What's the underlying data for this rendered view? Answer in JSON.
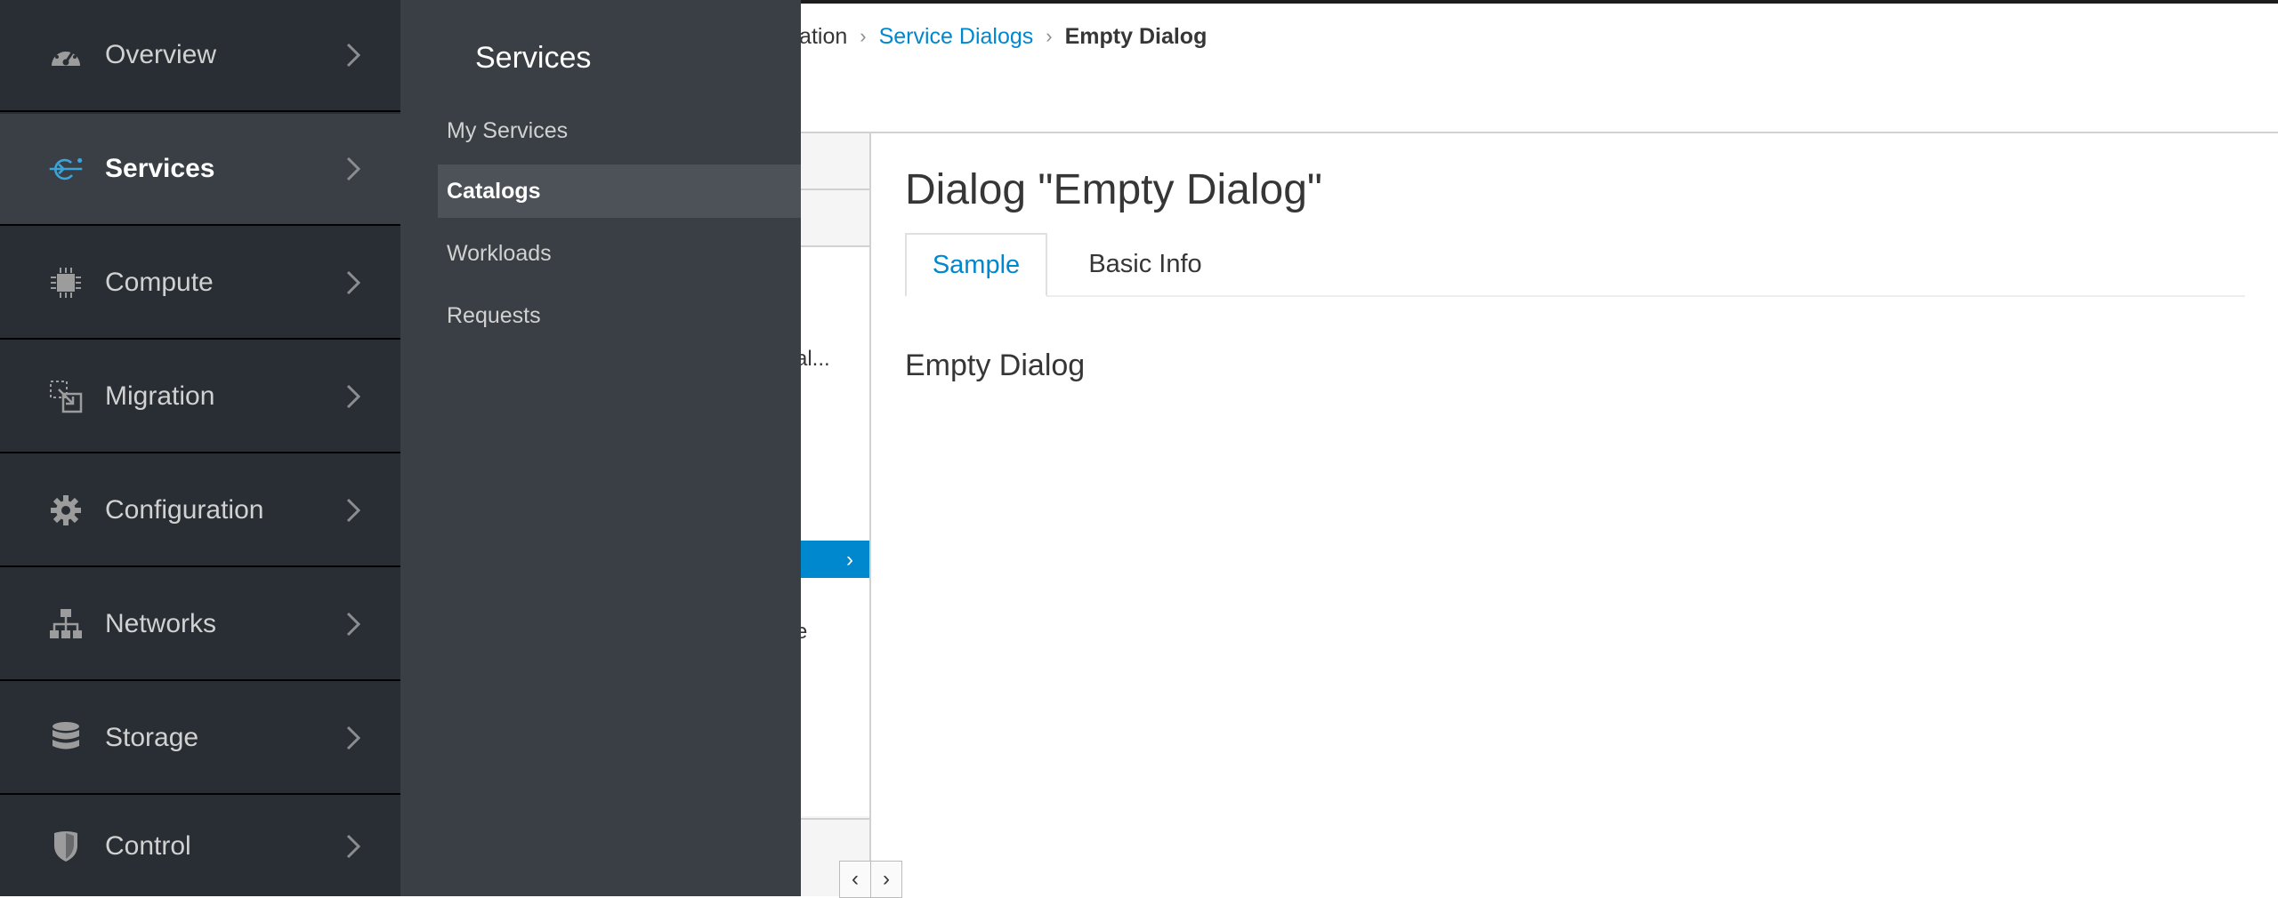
{
  "breadcrumb": {
    "items": [
      "ization",
      "Service Dialogs",
      "Empty Dialog"
    ]
  },
  "accordion": {
    "text_1": "al...",
    "text_2": "e",
    "selected_chevron": "›"
  },
  "pager": {
    "prev": "‹",
    "next": "›"
  },
  "main": {
    "title": "Dialog \"Empty Dialog\"",
    "tabs": [
      {
        "label": "Sample",
        "active": true
      },
      {
        "label": "Basic Info",
        "active": false
      }
    ],
    "dialog_label": "Empty Dialog"
  },
  "nav": {
    "items": [
      {
        "label": "Overview",
        "icon": "dashboard-icon"
      },
      {
        "label": "Services",
        "icon": "services-icon",
        "active": true
      },
      {
        "label": "Compute",
        "icon": "chip-icon"
      },
      {
        "label": "Migration",
        "icon": "migration-icon"
      },
      {
        "label": "Configuration",
        "icon": "gear-icon"
      },
      {
        "label": "Networks",
        "icon": "network-icon"
      },
      {
        "label": "Storage",
        "icon": "database-icon"
      },
      {
        "label": "Control",
        "icon": "shield-icon"
      }
    ]
  },
  "subnav": {
    "title": "Services",
    "items": [
      {
        "label": "My Services"
      },
      {
        "label": "Catalogs",
        "active": true
      },
      {
        "label": "Workloads"
      },
      {
        "label": "Requests"
      }
    ]
  },
  "colors": {
    "nav_bg": "#292e34",
    "subnav_bg": "#393f44",
    "accent": "#0088ce",
    "active_icon": "#39a5dc"
  }
}
